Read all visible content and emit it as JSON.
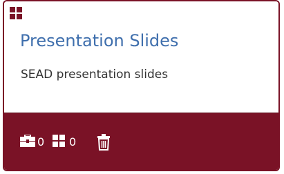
{
  "card": {
    "title": "Presentation Slides",
    "description": "SEAD presentation slides",
    "type_icon": "collection-grid-icon",
    "footer": {
      "datasets_icon": "briefcase-icon",
      "datasets_count": "0",
      "collections_icon": "grid-icon",
      "collections_count": "0",
      "delete_icon": "trash-icon"
    }
  },
  "colors": {
    "accent": "#7a1226",
    "title": "#3f6fad",
    "text": "#333333",
    "footer_text": "#ffffff"
  }
}
